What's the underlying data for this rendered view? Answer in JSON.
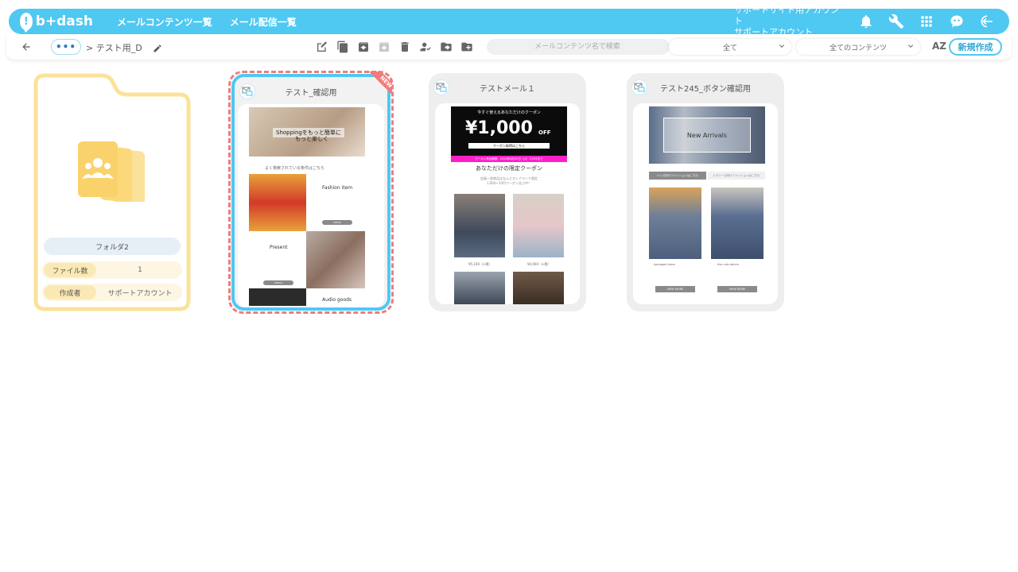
{
  "app": {
    "logo_text": "b+dash",
    "nav": [
      "メールコンテンツ一覧",
      "メール配信一覧"
    ],
    "account_line1": "サポートサイト用アカウント",
    "account_line2": "サポートアカウント"
  },
  "icons": {
    "top": [
      "bell-icon",
      "wrench-icon",
      "apps-grid-icon",
      "ai-assistant-icon",
      "logout-icon"
    ],
    "toolbar": [
      "new-content-icon",
      "copy-icon",
      "archive-icon",
      "unarchive-icon",
      "delete-icon",
      "assign-user-icon",
      "move-icon",
      "new-folder-icon"
    ]
  },
  "toolbar": {
    "dots": "•••",
    "breadcrumb": "> テスト用_D",
    "search_placeholder": "メールコンテンツ名で検索",
    "filter1": "全て",
    "filter2": "全てのコンテンツ",
    "sort_label": "AZ",
    "new_button": "新規作成"
  },
  "folder": {
    "name": "フォルダ2",
    "file_count_label": "ファイル数",
    "file_count": "1",
    "creator_label": "作成者",
    "creator": "サポートアカウント"
  },
  "cards": [
    {
      "title": "テスト_確認用",
      "badge": "NEW",
      "selected": true,
      "hero_text_1": "Shoppingをもっと簡単に",
      "hero_text_2": "もっと楽しく",
      "section_1": "よく検索されている条件はこちら",
      "item_1": "Fashion item",
      "item_2": "Present",
      "item_3": "Audio goods",
      "button": "CHECK"
    },
    {
      "title": "テストメール１",
      "headline": "今すぐ使えるあなただけのクーポン",
      "amount": "¥1,000",
      "amount_suffix": "OFF",
      "coupon_link": "クーポン取得はこちら",
      "deadline": "クーポン有効期限：2020年6月30日（火）23:59まで",
      "subtitle": "あなただけの限定クーポン",
      "desc_1": "会員一部商品はなんとストアランド限定",
      "desc_2": "1,000~10円クーポン及ぶ中！",
      "price_1": "¥5,100（+税）",
      "price_2": "¥4,000（+税）"
    },
    {
      "title": "テスト245_ボタン確認用",
      "hero_text": "New Arrivals",
      "tab_1": "メンズ向けファッションはこちら",
      "tab_2": "レディース向けファッションはこちら",
      "item_1": "damaged jeans",
      "item_2": "five cats denim",
      "button": "VIEW MORE"
    }
  ],
  "colors": {
    "brand": "#4fc8f2",
    "folder": "#fbe29a",
    "selected_dash": "#f17b7b",
    "coupon_pink": "#ff1fc9"
  }
}
